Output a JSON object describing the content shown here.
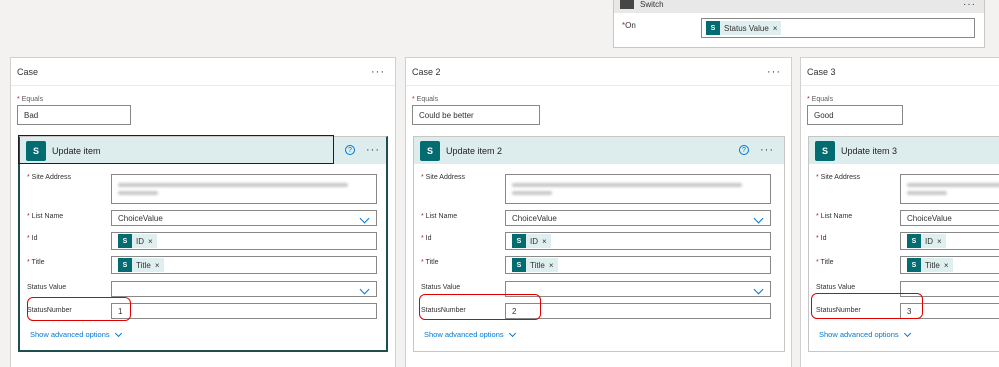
{
  "switch": {
    "title": "Switch",
    "on_label": "On",
    "token_label": "Status Value"
  },
  "cases": [
    {
      "title": "Case",
      "equals_label": "Equals",
      "equals_value": "Bad",
      "action": {
        "title": "Update item",
        "help": "?",
        "site_address_label": "Site Address",
        "list_name_label": "List Name",
        "list_name_value": "ChoiceValue",
        "id_label": "Id",
        "id_token": "ID",
        "title_label": "Title",
        "title_token": "Title",
        "status_value_label": "Status Value",
        "status_number_label": "StatusNumber",
        "status_number_value": "1",
        "advanced_label": "Show advanced options"
      }
    },
    {
      "title": "Case 2",
      "equals_label": "Equals",
      "equals_value": "Could be better",
      "action": {
        "title": "Update item 2",
        "help": "?",
        "site_address_label": "Site Address",
        "list_name_label": "List Name",
        "list_name_value": "ChoiceValue",
        "id_label": "Id",
        "id_token": "ID",
        "title_label": "Title",
        "title_token": "Title",
        "status_value_label": "Status Value",
        "status_number_label": "StatusNumber",
        "status_number_value": "2",
        "advanced_label": "Show advanced options"
      }
    },
    {
      "title": "Case 3",
      "equals_label": "Equals",
      "equals_value": "Good",
      "action": {
        "title": "Update item 3",
        "site_address_label": "Site Address",
        "list_name_label": "List Name",
        "list_name_value": "ChoiceValue",
        "id_label": "Id",
        "id_token": "ID",
        "title_label": "Title",
        "title_token": "Title",
        "status_value_label": "Status Value",
        "status_number_label": "StatusNumber",
        "status_number_value": "3",
        "advanced_label": "Show advanced options"
      }
    }
  ],
  "icons": {
    "more": "more-options-icon",
    "sharepoint": "sharepoint-icon",
    "help": "help-icon",
    "chevron": "chevron-down-icon",
    "close": "close-icon"
  },
  "colors": {
    "accent": "#0078d4",
    "sharepoint": "#036c70",
    "highlight": "#e00000"
  }
}
